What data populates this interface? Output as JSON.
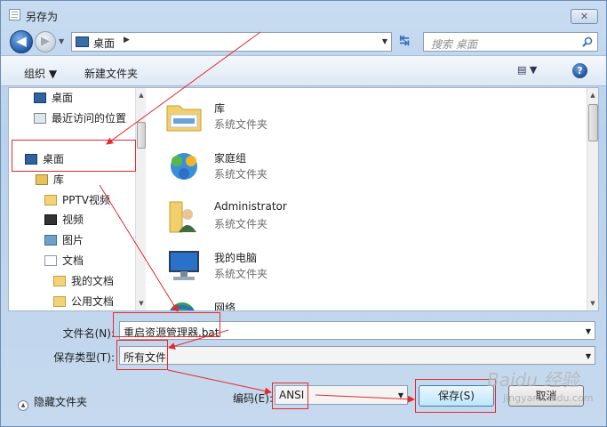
{
  "window": {
    "title": "另存为",
    "close_glyph": "✕"
  },
  "nav": {
    "back_glyph": "◀",
    "forward_glyph": "▶",
    "history_glyph": "▼",
    "address": {
      "current": "桌面",
      "chevron": "▶",
      "drop": "▼"
    },
    "refresh_glyph": "↹",
    "search_placeholder": "搜索 桌面"
  },
  "toolbar": {
    "organize": "组织 ▼",
    "new_folder": "新建文件夹",
    "views": "▤ ▼",
    "help": "?"
  },
  "sidebar": {
    "items": [
      {
        "label": "桌面",
        "icon": "desktop-icon"
      },
      {
        "label": "最近访问的位置",
        "icon": "recent-places-icon"
      },
      {
        "label": "桌面",
        "icon": "desktop-icon"
      },
      {
        "label": "库",
        "icon": "library-icon"
      },
      {
        "label": "PPTV视频",
        "icon": "folder-icon"
      },
      {
        "label": "视频",
        "icon": "video-icon"
      },
      {
        "label": "图片",
        "icon": "pictures-icon"
      },
      {
        "label": "文档",
        "icon": "documents-icon"
      },
      {
        "label": "我的文档",
        "icon": "folder-icon"
      },
      {
        "label": "公用文档",
        "icon": "folder-icon"
      }
    ]
  },
  "files": [
    {
      "name": "库",
      "type": "系统文件夹",
      "icon": "library-folder-icon"
    },
    {
      "name": "家庭组",
      "type": "系统文件夹",
      "icon": "homegroup-icon"
    },
    {
      "name": "Administrator",
      "type": "系统文件夹",
      "icon": "user-folder-icon"
    },
    {
      "name": "我的电脑",
      "type": "系统文件夹",
      "icon": "computer-icon"
    },
    {
      "name": "网络",
      "type": "",
      "icon": "network-icon"
    }
  ],
  "form": {
    "filename_label": "文件名(N):",
    "filename_value": "重启资源管理器.bat",
    "filetype_label": "保存类型(T):",
    "filetype_value": "所有文件",
    "encoding_label": "编码(E):",
    "encoding_value": "ANSI",
    "hide_folders": "隐藏文件夹",
    "save_button": "保存(S)",
    "cancel_button": "取消",
    "drop_glyph": "▼"
  },
  "colors": {
    "annotation": "#e8282b",
    "accent": "#3c7fb1"
  },
  "watermark": {
    "text": "Baidu 经验",
    "url": "jingyan.baidu.com"
  }
}
